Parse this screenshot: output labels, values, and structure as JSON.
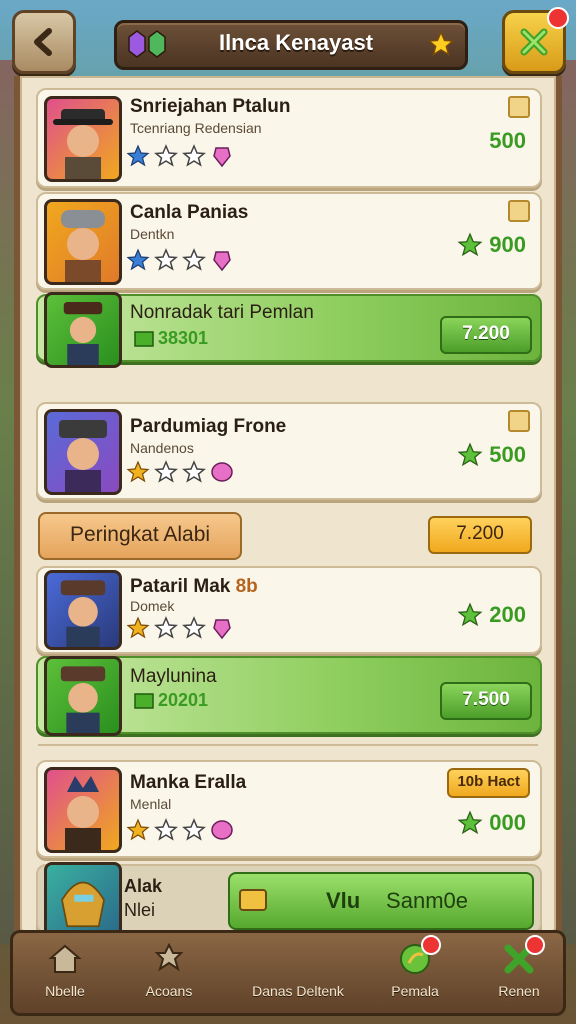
{
  "header": {
    "title": "Ilnca Kenayast",
    "back_icon": "back-arrow-icon",
    "close_icon": "close-x-icon"
  },
  "colors": {
    "price_green": "#3a9b22",
    "gold": "#f0a81e",
    "frame_brown": "#7a5836"
  },
  "rows": [
    {
      "name": "Snriejahan Ptalun",
      "sub": "Tcenriang Redensian",
      "price": "500",
      "stars": 1,
      "kind": "normal"
    },
    {
      "name": "Canla Panias",
      "sub": "Dentkn",
      "price": "900",
      "stars": 1,
      "kind": "normal"
    },
    {
      "name": "Nonradak tari Pemlan",
      "cash": "38301",
      "button": "7.200",
      "kind": "green"
    },
    {
      "name": "Pardumiag Frone",
      "sub": "Nandenos",
      "price": "500",
      "stars": 1,
      "kind": "normal"
    }
  ],
  "section": {
    "label": "Peringkat Alabi",
    "price": "7.200"
  },
  "rows2": [
    {
      "name": "Pataril Mak",
      "name_suffix": "8b",
      "sub": "Domek",
      "price": "200",
      "stars": 1,
      "kind": "normal"
    },
    {
      "name": "Maylunina",
      "cash": "20201",
      "button": "7.500",
      "kind": "green"
    },
    {
      "name": "Manka Eralla",
      "sub": "Menlal",
      "price": "000",
      "badge": "10b Hact",
      "stars": 1,
      "kind": "normal"
    }
  ],
  "promo": {
    "line1": "Alak",
    "line2": "Nlei",
    "left": "Vlu",
    "right": "Sanm0e"
  },
  "nav": [
    {
      "label": "Nbelle",
      "icon": "home-icon"
    },
    {
      "label": "Acoans",
      "icon": "character-icon"
    },
    {
      "label": "Danas Deltenk",
      "icon": ""
    },
    {
      "label": "Pemala",
      "icon": "gem-orb-icon"
    },
    {
      "label": "Renen",
      "icon": "close-x-icon"
    }
  ]
}
